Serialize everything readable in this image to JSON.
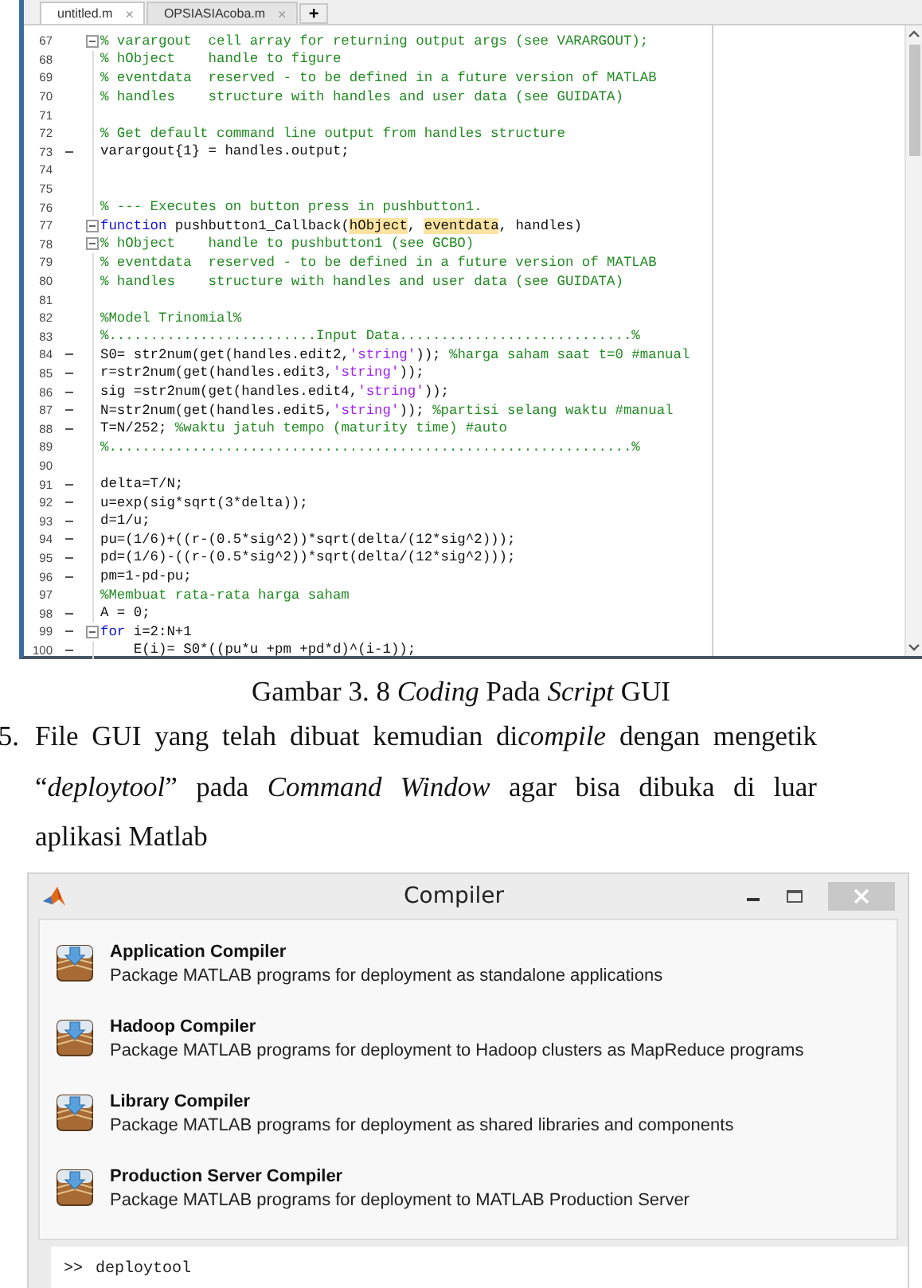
{
  "editor": {
    "tabs": [
      {
        "label": "untitled.m",
        "close": "×",
        "selected": true
      },
      {
        "label": "OPSIASIAcoba.m",
        "close": "×",
        "selected": false
      }
    ],
    "add_tab": "+",
    "lines": [
      {
        "number": "67",
        "executable": false,
        "fold": true,
        "segments": [
          {
            "kind": "comment",
            "text": "% varargout  cell array for returning output args (see VARARGOUT);"
          }
        ]
      },
      {
        "number": "68",
        "executable": false,
        "fold": false,
        "segments": [
          {
            "kind": "comment",
            "text": "% hObject    handle to figure"
          }
        ]
      },
      {
        "number": "69",
        "executable": false,
        "fold": false,
        "segments": [
          {
            "kind": "comment",
            "text": "% eventdata  reserved - to be defined in a future version of MATLAB"
          }
        ]
      },
      {
        "number": "70",
        "executable": false,
        "fold": false,
        "segments": [
          {
            "kind": "comment",
            "text": "% handles    structure with handles and user data (see GUIDATA)"
          }
        ]
      },
      {
        "number": "71",
        "executable": false,
        "fold": false
      },
      {
        "number": "72",
        "executable": false,
        "fold": false,
        "segments": [
          {
            "kind": "comment",
            "text": "% Get default command line output from handles structure"
          }
        ]
      },
      {
        "number": "73",
        "executable": true,
        "fold": false,
        "segments": [
          {
            "kind": "plain",
            "text": "varargout{1} = handles.output;"
          }
        ]
      },
      {
        "number": "74",
        "executable": false,
        "fold": false
      },
      {
        "number": "75",
        "executable": false,
        "fold": false
      },
      {
        "number": "76",
        "executable": false,
        "fold": false,
        "segments": [
          {
            "kind": "comment",
            "text": "% --- Executes on button press in pushbutton1."
          }
        ]
      },
      {
        "number": "77",
        "executable": false,
        "fold": true,
        "segments": [
          {
            "kind": "keyword",
            "text": "function"
          },
          {
            "kind": "plain",
            "text": " pushbutton1_Callback("
          },
          {
            "kind": "highlight",
            "text": "hObject"
          },
          {
            "kind": "plain",
            "text": ", "
          },
          {
            "kind": "highlight",
            "text": "eventdata"
          },
          {
            "kind": "plain",
            "text": ", handles)"
          }
        ]
      },
      {
        "number": "78",
        "executable": false,
        "fold": true,
        "segments": [
          {
            "kind": "comment",
            "text": "% hObject    handle to pushbutton1 (see GCBO)"
          }
        ]
      },
      {
        "number": "79",
        "executable": false,
        "fold": false,
        "segments": [
          {
            "kind": "comment",
            "text": "% eventdata  reserved - to be defined in a future version of MATLAB"
          }
        ]
      },
      {
        "number": "80",
        "executable": false,
        "fold": false,
        "segments": [
          {
            "kind": "comment",
            "text": "% handles    structure with handles and user data (see GUIDATA)"
          }
        ]
      },
      {
        "number": "81",
        "executable": false,
        "fold": false
      },
      {
        "number": "82",
        "executable": false,
        "fold": false,
        "segments": [
          {
            "kind": "comment",
            "text": "%Model Trinomial%"
          }
        ]
      },
      {
        "number": "83",
        "executable": false,
        "fold": false,
        "segments": [
          {
            "kind": "comment",
            "text": "%.........................Input Data............................%"
          }
        ]
      },
      {
        "number": "84",
        "executable": true,
        "fold": false,
        "segments": [
          {
            "kind": "plain",
            "text": "S0= str2num(get(handles.edit2,"
          },
          {
            "kind": "string",
            "text": "'string'"
          },
          {
            "kind": "plain",
            "text": ")); "
          },
          {
            "kind": "comment",
            "text": "%harga saham saat t=0 #manual"
          }
        ]
      },
      {
        "number": "85",
        "executable": true,
        "fold": false,
        "segments": [
          {
            "kind": "plain",
            "text": "r=str2num(get(handles.edit3,"
          },
          {
            "kind": "string",
            "text": "'string'"
          },
          {
            "kind": "plain",
            "text": "));"
          }
        ]
      },
      {
        "number": "86",
        "executable": true,
        "fold": false,
        "segments": [
          {
            "kind": "plain",
            "text": "sig =str2num(get(handles.edit4,"
          },
          {
            "kind": "string",
            "text": "'string'"
          },
          {
            "kind": "plain",
            "text": "));"
          }
        ]
      },
      {
        "number": "87",
        "executable": true,
        "fold": false,
        "segments": [
          {
            "kind": "plain",
            "text": "N=str2num(get(handles.edit5,"
          },
          {
            "kind": "string",
            "text": "'string'"
          },
          {
            "kind": "plain",
            "text": ")); "
          },
          {
            "kind": "comment",
            "text": "%partisi selang waktu #manual"
          }
        ]
      },
      {
        "number": "88",
        "executable": true,
        "fold": false,
        "segments": [
          {
            "kind": "plain",
            "text": "T=N/252; "
          },
          {
            "kind": "comment",
            "text": "%waktu jatuh tempo (maturity time) #auto"
          }
        ]
      },
      {
        "number": "89",
        "executable": false,
        "fold": false,
        "segments": [
          {
            "kind": "comment",
            "text": "%...............................................................%"
          }
        ]
      },
      {
        "number": "90",
        "executable": false,
        "fold": false
      },
      {
        "number": "91",
        "executable": true,
        "fold": false,
        "segments": [
          {
            "kind": "plain",
            "text": "delta=T/N;"
          }
        ]
      },
      {
        "number": "92",
        "executable": true,
        "fold": false,
        "segments": [
          {
            "kind": "plain",
            "text": "u=exp(sig*sqrt(3*delta));"
          }
        ]
      },
      {
        "number": "93",
        "executable": true,
        "fold": false,
        "segments": [
          {
            "kind": "plain",
            "text": "d=1/u;"
          }
        ]
      },
      {
        "number": "94",
        "executable": true,
        "fold": false,
        "segments": [
          {
            "kind": "plain",
            "text": "pu=(1/6)+((r-(0.5*sig^2))*sqrt(delta/(12*sig^2)));"
          }
        ]
      },
      {
        "number": "95",
        "executable": true,
        "fold": false,
        "segments": [
          {
            "kind": "plain",
            "text": "pd=(1/6)-((r-(0.5*sig^2))*sqrt(delta/(12*sig^2)));"
          }
        ]
      },
      {
        "number": "96",
        "executable": true,
        "fold": false,
        "segments": [
          {
            "kind": "plain",
            "text": "pm=1-pd-pu;"
          }
        ]
      },
      {
        "number": "97",
        "executable": false,
        "fold": false,
        "segments": [
          {
            "kind": "comment",
            "text": "%Membuat rata-rata harga saham"
          }
        ]
      },
      {
        "number": "98",
        "executable": true,
        "fold": false,
        "segments": [
          {
            "kind": "plain",
            "text": "A = 0;"
          }
        ]
      },
      {
        "number": "99",
        "executable": true,
        "fold": true,
        "segments": [
          {
            "kind": "keyword",
            "text": "for"
          },
          {
            "kind": "plain",
            "text": " i=2:N+1"
          }
        ]
      },
      {
        "number": "100",
        "executable": true,
        "fold": false,
        "segments": [
          {
            "kind": "plain",
            "text": "    E(i)= S0*((pu*u +pm +pd*d)^(i-1));"
          }
        ]
      }
    ]
  },
  "caption": "Gambar 3. 8 *Coding* Pada *Script* GUI",
  "list_item": {
    "number": "5.",
    "segments": [
      {
        "text": "File GUI yang telah dibuat kemudian di",
        "italic": false
      },
      {
        "text": "compile",
        "italic": true
      },
      {
        "text": " dengan mengetik “",
        "italic": false
      },
      {
        "text": "deploytool",
        "italic": true
      },
      {
        "text": "” pada ",
        "italic": false
      },
      {
        "text": "Command Window",
        "italic": true
      },
      {
        "text": " agar bisa dibuka di luar aplikasi Matlab",
        "italic": false
      }
    ]
  },
  "compiler": {
    "title": "Compiler",
    "apps": [
      {
        "name": "Application Compiler",
        "description": "Package MATLAB programs for deployment as standalone applications"
      },
      {
        "name": "Hadoop Compiler",
        "description": "Package MATLAB programs for deployment to Hadoop clusters as MapReduce programs"
      },
      {
        "name": "Library Compiler",
        "description": "Package MATLAB programs for deployment as shared libraries and components"
      },
      {
        "name": "Production Server Compiler",
        "description": "Package MATLAB programs for deployment to MATLAB Production Server"
      }
    ]
  },
  "command_window": {
    "prompt": ">>",
    "command": "deploytool"
  }
}
